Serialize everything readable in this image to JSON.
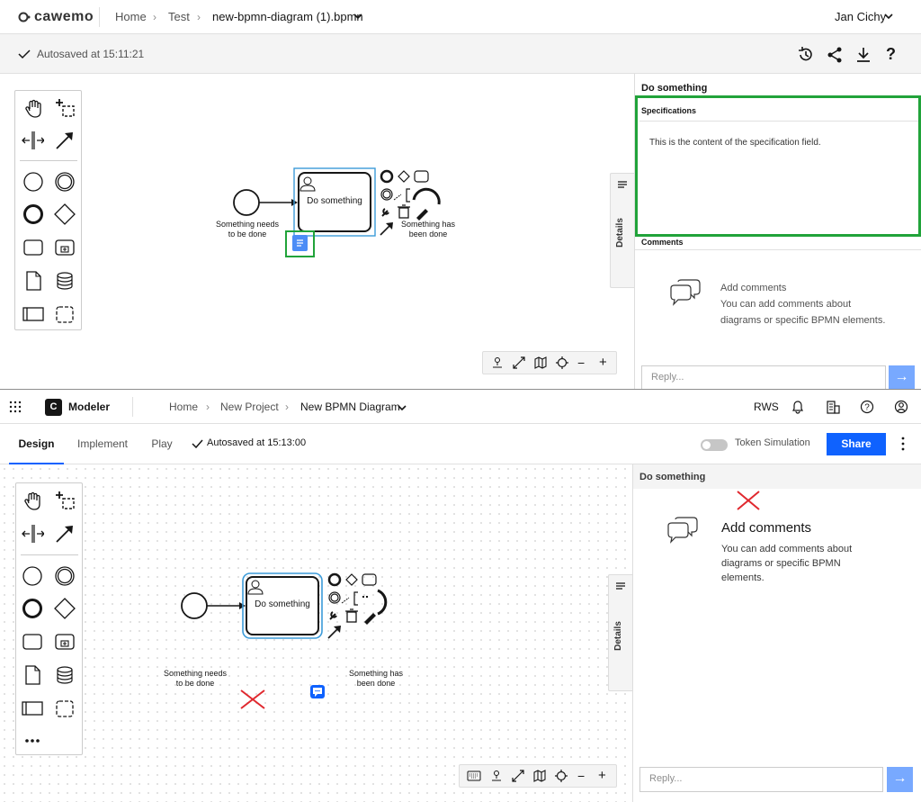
{
  "top": {
    "logo": "cawemo",
    "breadcrumb": [
      "Home",
      "Test",
      "new-bpmn-diagram (1).bpmn"
    ],
    "user": "Jan Cichy",
    "autosave": "Autosaved at 15:11:21",
    "diagram": {
      "start_label_1": "Something needs",
      "start_label_2": "to be done",
      "task_label": "Do something",
      "end_label_1": "Something has",
      "end_label_2": "been done"
    },
    "details_tab": "Details",
    "panel": {
      "element_title": "Do something",
      "spec_title": "Specifications",
      "spec_content": "This is the content of the specification field.",
      "comments_title": "Comments",
      "comments_heading": "Add comments",
      "comments_text_1": "You can add comments about",
      "comments_text_2": "diagrams or specific BPMN elements.",
      "reply_placeholder": "Reply..."
    }
  },
  "bottom": {
    "app_name": "Modeler",
    "breadcrumb": [
      "Home",
      "New Project",
      "New BPMN Diagram"
    ],
    "org": "RWS",
    "tabs": [
      "Design",
      "Implement",
      "Play"
    ],
    "autosave": "Autosaved at 15:13:00",
    "token_simulation": "Token Simulation",
    "share": "Share",
    "diagram": {
      "start_label_1": "Something needs",
      "start_label_2": "to be done",
      "task_label": "Do something",
      "end_label_1": "Something has",
      "end_label_2": "been done"
    },
    "details_tab": "Details",
    "panel": {
      "element_title": "Do something",
      "comments_heading": "Add comments",
      "comments_text_1": "You can add comments about",
      "comments_text_2": "diagrams or specific BPMN",
      "comments_text_3": "elements.",
      "reply_placeholder": "Reply..."
    }
  },
  "colors": {
    "highlight_box": "#21a33a",
    "error_cross": "#e0282e",
    "selection": "#3c9bd9",
    "primary": "#0f62fe"
  }
}
